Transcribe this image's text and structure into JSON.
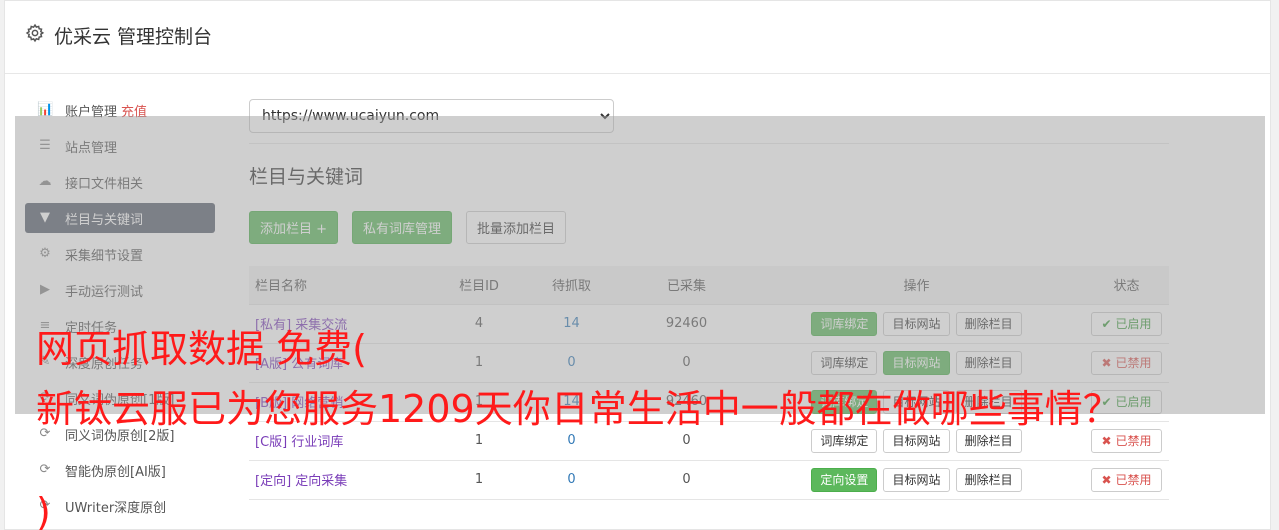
{
  "header": {
    "title": "优采云 管理控制台"
  },
  "sidebar": {
    "items": [
      {
        "label": "账户管理",
        "extra": "充值",
        "icon": "bar-chart-icon",
        "glyph": "📊"
      },
      {
        "label": "站点管理",
        "icon": "server-icon",
        "glyph": "☰"
      },
      {
        "label": "接口文件相关",
        "icon": "cloud-upload-icon",
        "glyph": "☁"
      },
      {
        "label": "栏目与关键词",
        "icon": "filter-icon",
        "glyph": "▼",
        "active": true
      },
      {
        "label": "采集细节设置",
        "icon": "cogs-icon",
        "glyph": "⚙"
      },
      {
        "label": "手动运行测试",
        "icon": "play-icon",
        "glyph": "▶"
      },
      {
        "label": "定时任务",
        "icon": "list-icon",
        "glyph": "≡"
      },
      {
        "label": "深度原创任务",
        "icon": "edit-icon",
        "glyph": "✎"
      },
      {
        "label": "同义词伪原创[1版]",
        "icon": "refresh-icon",
        "glyph": "⟳"
      },
      {
        "label": "同义词伪原创[2版]",
        "icon": "refresh-icon",
        "glyph": "⟳"
      },
      {
        "label": "智能伪原创[AI版]",
        "icon": "refresh-icon",
        "glyph": "⟳"
      },
      {
        "label": "UWriter深度原创",
        "icon": "refresh-icon",
        "glyph": "⟳"
      }
    ]
  },
  "main": {
    "site_select": {
      "value": "https://www.ucaiyun.com"
    },
    "section_title": "栏目与关键词",
    "buttons": {
      "add": "添加栏目 +",
      "private": "私有词库管理",
      "batch": "批量添加栏目"
    },
    "table": {
      "headers": [
        "栏目名称",
        "栏目ID",
        "待抓取",
        "已采集",
        "操作",
        "状态"
      ],
      "rows": [
        {
          "tag": "[私有]",
          "name": "采集交流",
          "id": "4",
          "pending": "14",
          "collected": "92460",
          "op1": "词库绑定",
          "op1_green": true,
          "op2": "目标网站",
          "op2_green": false,
          "op3": "删除栏目",
          "status": "已启用",
          "status_on": true
        },
        {
          "tag": "[A版]",
          "name": "公有词库",
          "id": "1",
          "pending": "0",
          "collected": "0",
          "op1": "词库绑定",
          "op1_green": false,
          "op2": "目标网站",
          "op2_green": true,
          "op3": "删除栏目",
          "status": "已禁用",
          "status_on": false
        },
        {
          "tag": "[B版]",
          "name": "网络营销",
          "id": "1",
          "pending": "14",
          "collected": "92460",
          "op1": "词库绑定",
          "op1_green": true,
          "op2": "目标网站",
          "op2_green": false,
          "op3": "删除栏目",
          "status": "已启用",
          "status_on": true
        },
        {
          "tag": "[C版]",
          "name": "行业词库",
          "id": "1",
          "pending": "0",
          "collected": "0",
          "op1": "词库绑定",
          "op1_green": false,
          "op2": "目标网站",
          "op2_green": false,
          "op3": "删除栏目",
          "status": "已禁用",
          "status_on": false
        },
        {
          "tag": "[定向]",
          "name": "定向采集",
          "id": "1",
          "pending": "0",
          "collected": "0",
          "op1": "定向设置",
          "op1_green": true,
          "op2": "目标网站",
          "op2_green": false,
          "op3": "删除栏目",
          "status": "已禁用",
          "status_on": false
        }
      ]
    }
  },
  "watermark": {
    "line1": "网页抓取数据 免费(",
    "line2": "新钛云服已为您服务1209天你日常生活中一般都在做哪些事情？",
    "line3": ")"
  }
}
